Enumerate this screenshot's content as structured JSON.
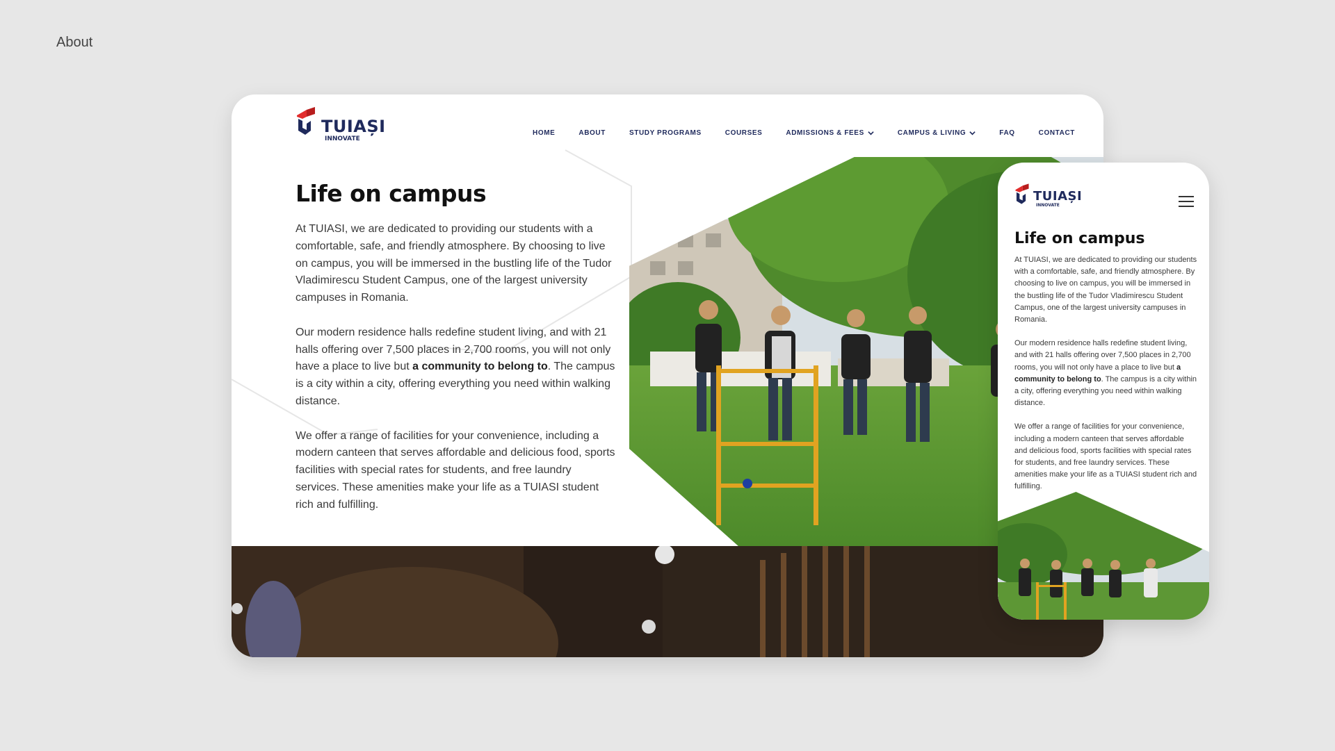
{
  "page_label": "About",
  "brand": {
    "name": "TUIAȘI",
    "tagline": "INNOVATE",
    "colors": {
      "red": "#e22d2d",
      "navy": "#1f2a5c"
    }
  },
  "nav": {
    "items": [
      {
        "label": "HOME",
        "has_dropdown": false
      },
      {
        "label": "ABOUT",
        "has_dropdown": false
      },
      {
        "label": "STUDY PROGRAMS",
        "has_dropdown": false
      },
      {
        "label": "COURSES",
        "has_dropdown": false
      },
      {
        "label": "ADMISSIONS & FEES",
        "has_dropdown": true
      },
      {
        "label": "CAMPUS & LIVING",
        "has_dropdown": true
      },
      {
        "label": "FAQ",
        "has_dropdown": false
      },
      {
        "label": "CONTACT",
        "has_dropdown": false
      }
    ],
    "mobile_menu_icon": "hamburger-icon"
  },
  "content": {
    "title": "Life on campus",
    "p1": "At TUIASI, we are dedicated to providing our students with a comfortable, safe, and friendly atmosphere. By choosing to live on campus, you will be immersed in the bustling life of the Tudor Vladimirescu Student Campus, one of the largest university campuses in Romania.",
    "p2_before": "Our modern residence halls redefine student living, and with 21 halls offering over 7,500 places in 2,700 rooms, you will not only have a place to live but ",
    "p2_bold": "a community to belong to",
    "p2_after": ". The campus is a city within a city, offering everything you need within walking distance.",
    "p3": "We offer a range of facilities for your convenience, including a modern canteen that serves affordable and delicious food, sports facilities with special rates for students, and free laundry services. These amenities make your life as a TUIASI student rich and fulfilling."
  },
  "images": {
    "hero": "students-playing-ladder-toss-on-campus-lawn",
    "strip": "library-interior-dark"
  }
}
